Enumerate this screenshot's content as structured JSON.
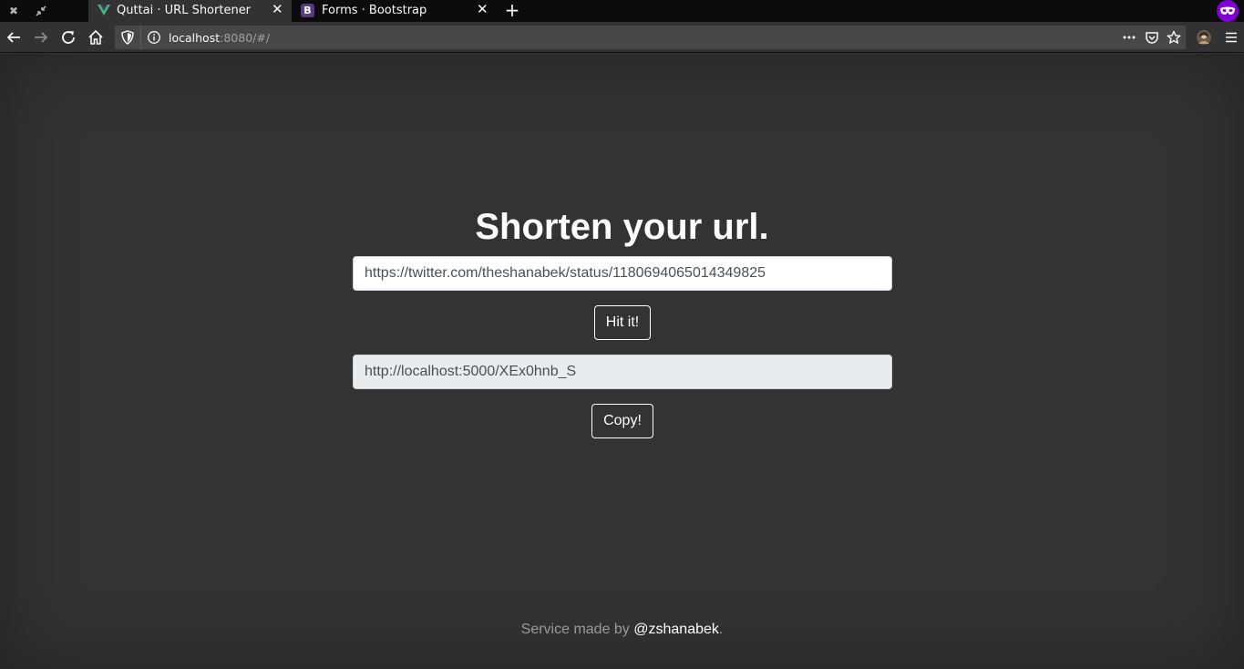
{
  "browser": {
    "tabs": [
      {
        "title": "Quttai · URL Shortener",
        "active": true,
        "favicon": "vue-icon"
      },
      {
        "title": "Forms · Bootstrap",
        "active": false,
        "favicon": "bootstrap-icon",
        "favicon_letter": "B"
      }
    ],
    "url_host": "localhost",
    "url_rest": ":8080/#/"
  },
  "page": {
    "heading": "Shorten your url.",
    "url_input_value": "https://twitter.com/theshanabek/status/1180694065014349825",
    "submit_label": "Hit it!",
    "result_value": "http://localhost:5000/XEx0hnb_S",
    "copy_label": "Copy!",
    "footer_prefix": "Service made by ",
    "footer_link": "@zshanabek",
    "footer_suffix": "."
  },
  "colors": {
    "page_bg": "#333333",
    "chrome_bg": "#0c0c0d",
    "toolbar_bg": "#323234",
    "private_badge": "#8000d7",
    "vue_green": "#41b883",
    "bootstrap_purple": "#563d7c"
  }
}
